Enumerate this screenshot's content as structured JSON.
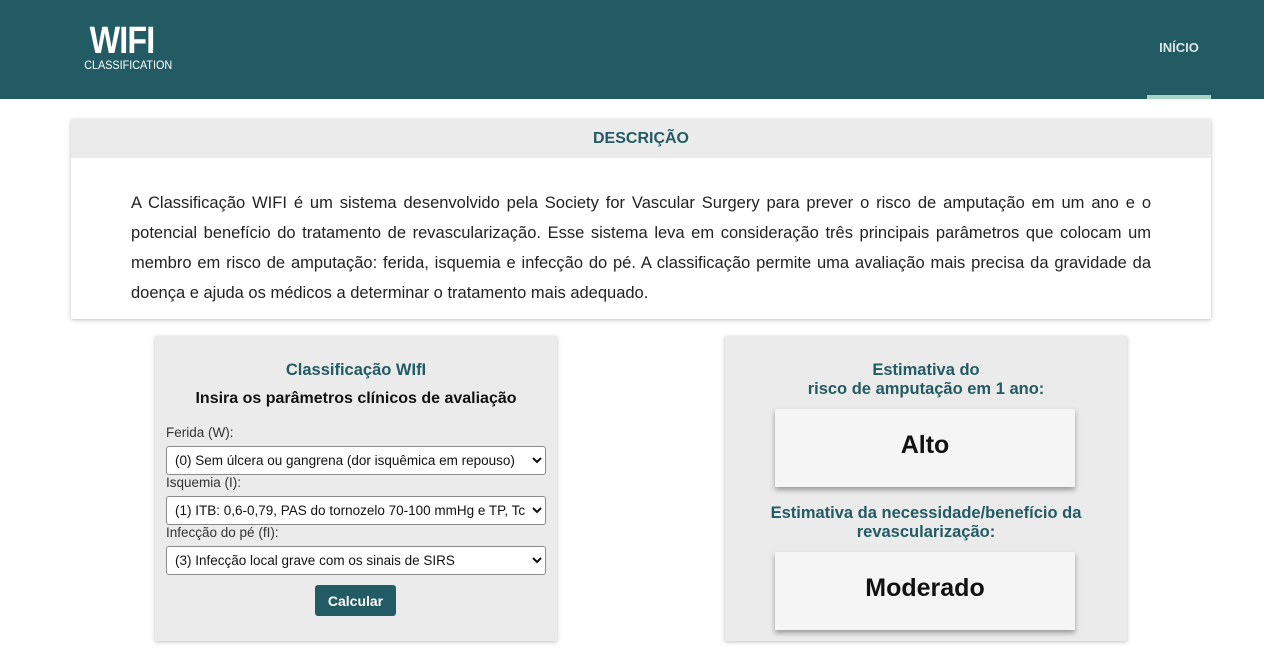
{
  "header": {
    "logo_main": "WIFI",
    "logo_sub": "CLASSIFICATION",
    "nav_inicio": "INÍCIO",
    "background_color": "#235b64",
    "active_underline_color": "#a8d4c3"
  },
  "description": {
    "heading": "DESCRIÇÃO",
    "text": "A Classificação WIFI é um sistema desenvolvido pela Society for Vascular Surgery para prever o risco de amputação em um ano e o potencial benefício do tratamento de revascularização. Esse sistema leva em consideração três principais parâmetros que colocam um membro em risco de amputação: ferida, isquemia e infecção do pé. A classificação permite uma avaliação mais precisa da gravidade da doença e ajuda os médicos a determinar o tratamento mais adequado."
  },
  "form": {
    "title": "Classificação WIfI",
    "subtitle": "Insira os parâmetros clínicos de avaliação",
    "wound_label": "Ferida (W):",
    "wound_value": "(0) Sem úlcera ou gangrena (dor isquêmica em repouso)",
    "ischemia_label": "Isquemia (I):",
    "ischemia_value": "(1) ITB: 0,6-0,79, PAS do tornozelo 70-100 mmHg e TP, Tc",
    "infection_label": "Infecção do pé (fI):",
    "infection_value": "(3) Infecção local grave com os sinais de SIRS",
    "calculate_label": "Calcular"
  },
  "results": {
    "amputation_title_line1": "Estimativa do",
    "amputation_title_line2": "risco de amputação em 1 ano:",
    "amputation_value": "Alto",
    "revasc_title_line1": "Estimativa da necessidade/benefício da",
    "revasc_title_line2": "revascularização:",
    "revasc_value": "Moderado"
  },
  "colors": {
    "accent": "#235b64",
    "panel_bg": "#ebebeb"
  }
}
